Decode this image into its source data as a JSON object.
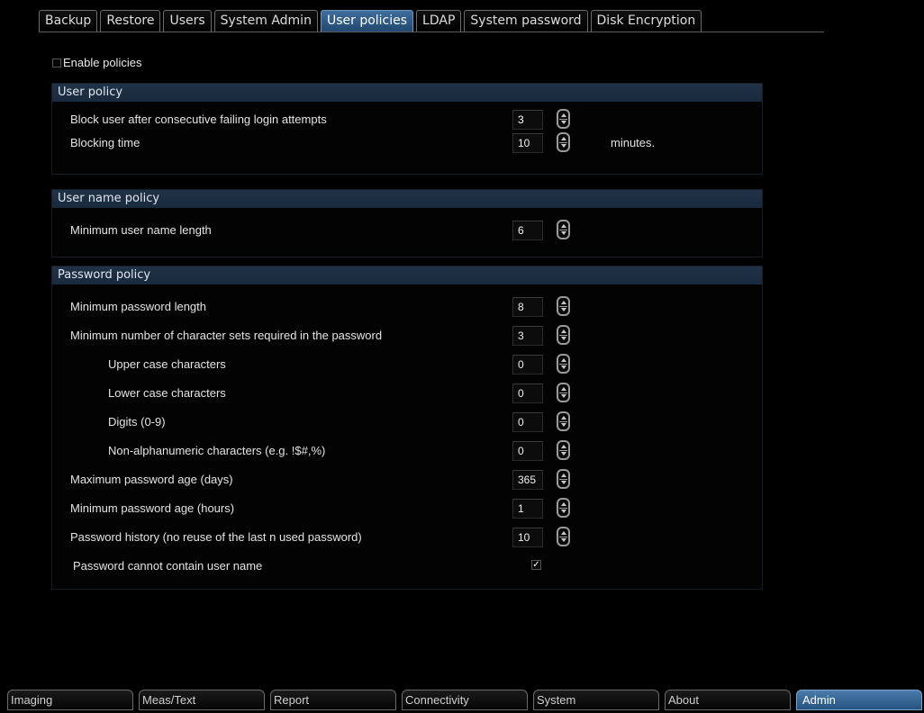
{
  "tabs": [
    {
      "label": "Backup",
      "active": false
    },
    {
      "label": "Restore",
      "active": false
    },
    {
      "label": "Users",
      "active": false
    },
    {
      "label": "System Admin",
      "active": false
    },
    {
      "label": "User policies",
      "active": true
    },
    {
      "label": "LDAP",
      "active": false
    },
    {
      "label": "System password",
      "active": false
    },
    {
      "label": "Disk Encryption",
      "active": false
    }
  ],
  "enable_policies": {
    "label": "Enable policies",
    "checked": false
  },
  "user_policy": {
    "title": "User policy",
    "block_after": {
      "label": "Block user after consecutive failing login attempts",
      "value": "3"
    },
    "blocking_time": {
      "label": "Blocking time",
      "value": "10",
      "unit": "minutes."
    }
  },
  "user_name_policy": {
    "title": "User name policy",
    "min_length": {
      "label": "Minimum user name length",
      "value": "6"
    }
  },
  "password_policy": {
    "title": "Password policy",
    "min_length": {
      "label": "Minimum password length",
      "value": "8"
    },
    "min_charsets": {
      "label": "Minimum number of character sets required in the password",
      "value": "3"
    },
    "upper": {
      "label": "Upper case characters",
      "value": "0"
    },
    "lower": {
      "label": "Lower case characters",
      "value": "0"
    },
    "digits": {
      "label": "Digits (0-9)",
      "value": "0"
    },
    "nonalnum": {
      "label": "Non-alphanumeric characters (e.g. !$#,%)",
      "value": "0"
    },
    "max_age": {
      "label": "Maximum password age (days)",
      "value": "365"
    },
    "min_age": {
      "label": "Minimum password age (hours)",
      "value": "1"
    },
    "history": {
      "label": "Password history (no reuse of the last n used password)",
      "value": "10"
    },
    "no_username": {
      "label": "Password cannot contain user name",
      "checked": true,
      "mark": "✓"
    }
  },
  "bottom_tabs": [
    {
      "label": "Imaging",
      "active": false
    },
    {
      "label": "Meas/Text",
      "active": false
    },
    {
      "label": "Report",
      "active": false
    },
    {
      "label": "Connectivity",
      "active": false
    },
    {
      "label": "System",
      "active": false
    },
    {
      "label": "About",
      "active": false
    },
    {
      "label": "Admin",
      "active": true
    }
  ],
  "colors": {
    "active_tab": "#2f5d8c",
    "section_header": "#1d2e42",
    "background": "#000000"
  }
}
